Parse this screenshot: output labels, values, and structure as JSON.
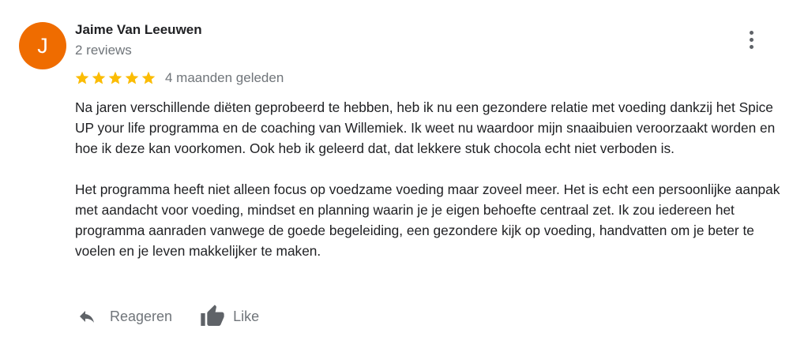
{
  "review": {
    "author": {
      "initial": "J",
      "name": "Jaime Van Leeuwen",
      "reviews_count": "2 reviews",
      "avatar_color": "#ef6c00"
    },
    "more_menu_icon": "more-vert-icon",
    "rating": 5,
    "rating_max": 5,
    "star_color": "#fbbc04",
    "date": "4 maanden geleden",
    "paragraphs": [
      "Na jaren verschillende diëten geprobeerd te hebben, heb ik nu een gezondere relatie met voeding dankzij het Spice UP your life programma en de coaching van Willemiek. Ik weet nu waardoor mijn snaaibuien veroorzaakt worden en hoe ik deze kan voorkomen. Ook heb ik geleerd dat, dat lekkere stuk chocola echt niet verboden is.",
      "Het programma heeft niet alleen focus op voedzame voeding maar zoveel meer. Het is echt een persoonlijke aanpak met aandacht voor voeding, mindset en planning waarin je je eigen behoefte centraal zet. Ik zou iedereen het programma aanraden vanwege de goede begeleiding, een gezondere kijk op voeding, handvatten om je beter te voelen en je leven makkelijker te maken."
    ],
    "actions": {
      "reply_label": "Reageren",
      "reply_icon": "reply-icon",
      "like_label": "Like",
      "like_icon": "thumbs-up-icon"
    }
  }
}
